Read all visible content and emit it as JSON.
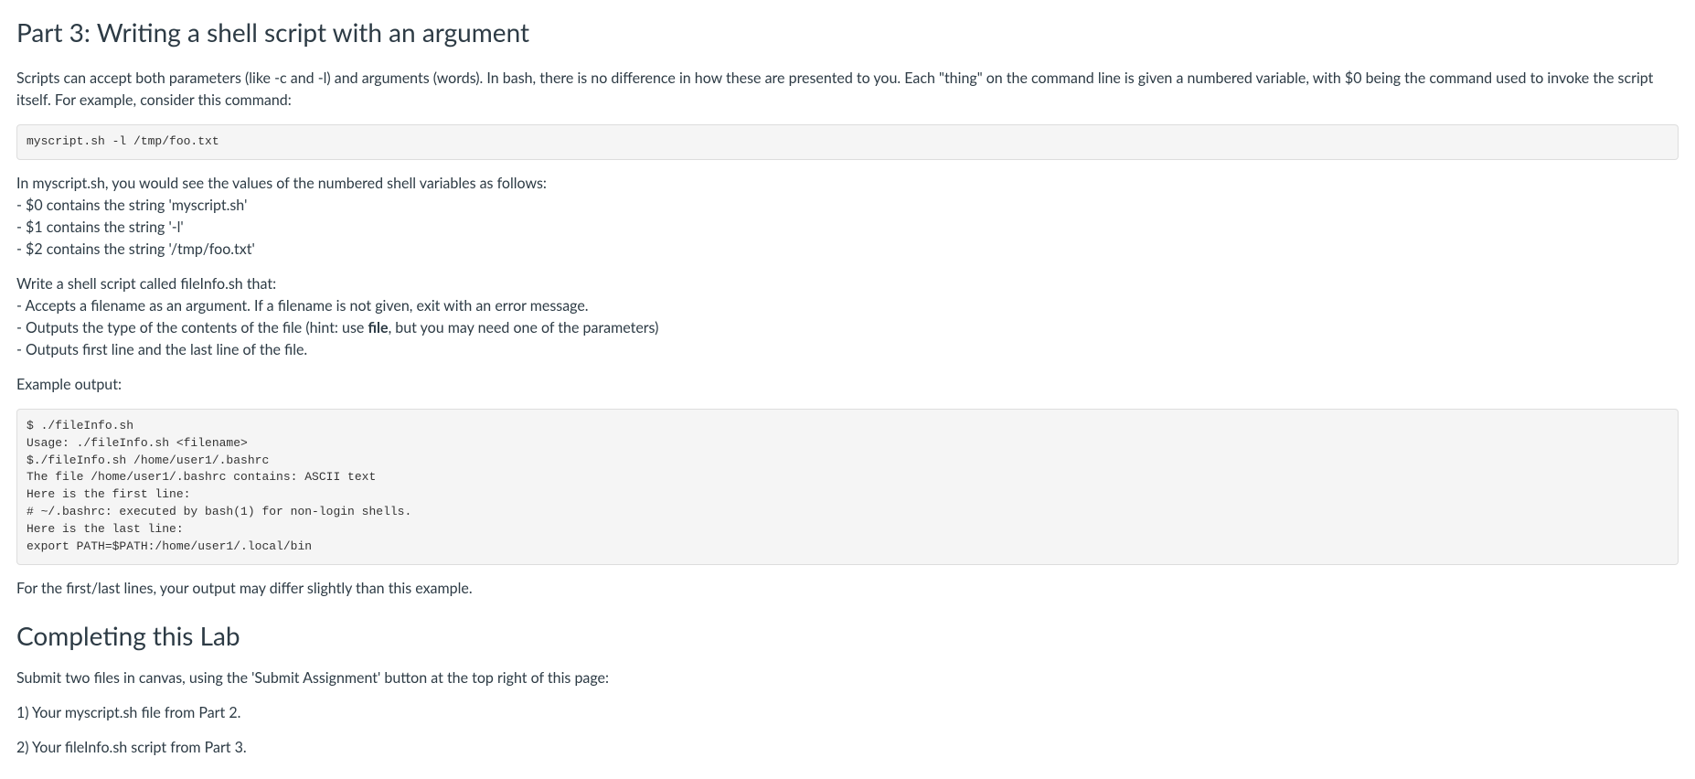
{
  "heading_part3": "Part 3: Writing a shell script with an argument",
  "para_intro": "Scripts can accept both parameters (like -c and -l) and arguments (words). In bash, there is no difference in how these are presented to you. Each \"thing\" on the command line is given a numbered variable, with $0 being the command used to invoke the script itself. For example, consider this command:",
  "code_block1": "myscript.sh -l /tmp/foo.txt",
  "vars_block": {
    "intro": "In myscript.sh, you would see the values of the numbered shell variables as follows:",
    "line0": "- $0 contains the string 'myscript.sh'",
    "line1": "- $1 contains the string '-l'",
    "line2": "- $2 contains the string '/tmp/foo.txt'"
  },
  "instructions": {
    "intro": "Write a shell script called fileInfo.sh that:",
    "item1": "- Accepts a filename as an argument.  If a filename is not given, exit with an error message.",
    "item2_prefix": "- Outputs the type of the contents of the file (hint: use ",
    "item2_bold": "file",
    "item2_suffix": ", but you may need one of the parameters)",
    "item3": "- Outputs first line and the last line of the file."
  },
  "example_label": "Example output:",
  "code_block2": "$ ./fileInfo.sh\nUsage: ./fileInfo.sh <filename>\n$./fileInfo.sh /home/user1/.bashrc\nThe file /home/user1/.bashrc contains: ASCII text\nHere is the first line:\n# ~/.bashrc: executed by bash(1) for non-login shells.\nHere is the last line:\nexport PATH=$PATH:/home/user1/.local/bin",
  "note_differ": "For the first/last lines, your output may differ slightly than this example.",
  "heading_completing": "Completing this Lab",
  "submit_intro": "Submit two files in canvas, using the 'Submit Assignment' button at the top right of this page:",
  "submit_item1": "1) Your myscript.sh file from Part 2.",
  "submit_item2": "2) Your fileInfo.sh script from Part 3."
}
